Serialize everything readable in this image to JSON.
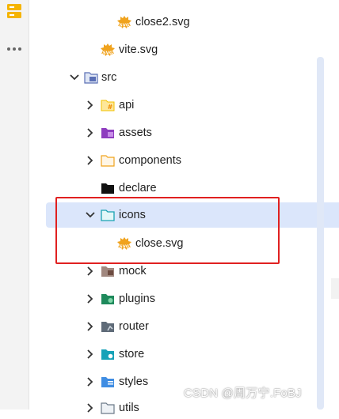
{
  "activity_bar": {
    "icons": [
      "database-icon",
      "more-icon"
    ]
  },
  "tree": {
    "items": [
      {
        "label": "close2.svg",
        "type": "svg-file"
      },
      {
        "label": "vite.svg",
        "type": "svg-file"
      },
      {
        "label": "src",
        "type": "src-folder",
        "expanded": true
      },
      {
        "label": "api",
        "type": "api-folder",
        "expanded": false
      },
      {
        "label": "assets",
        "type": "assets-folder",
        "expanded": false
      },
      {
        "label": "components",
        "type": "components-folder",
        "expanded": false
      },
      {
        "label": "declare",
        "type": "declare-folder"
      },
      {
        "label": "icons",
        "type": "icons-folder",
        "expanded": true,
        "selected": true
      },
      {
        "label": "close.svg",
        "type": "svg-file"
      },
      {
        "label": "mock",
        "type": "mock-folder",
        "expanded": false
      },
      {
        "label": "plugins",
        "type": "plugins-folder",
        "expanded": false
      },
      {
        "label": "router",
        "type": "router-folder",
        "expanded": false
      },
      {
        "label": "store",
        "type": "store-folder",
        "expanded": false
      },
      {
        "label": "styles",
        "type": "styles-folder",
        "expanded": false
      },
      {
        "label": "utils",
        "type": "utils-folder",
        "expanded": false
      }
    ]
  },
  "colors": {
    "selection": "#dbe6fb",
    "highlight_box": "#e02020",
    "svg_icon": "#f0a31e"
  },
  "watermark": "CSDN @周万宁.FoBJ"
}
